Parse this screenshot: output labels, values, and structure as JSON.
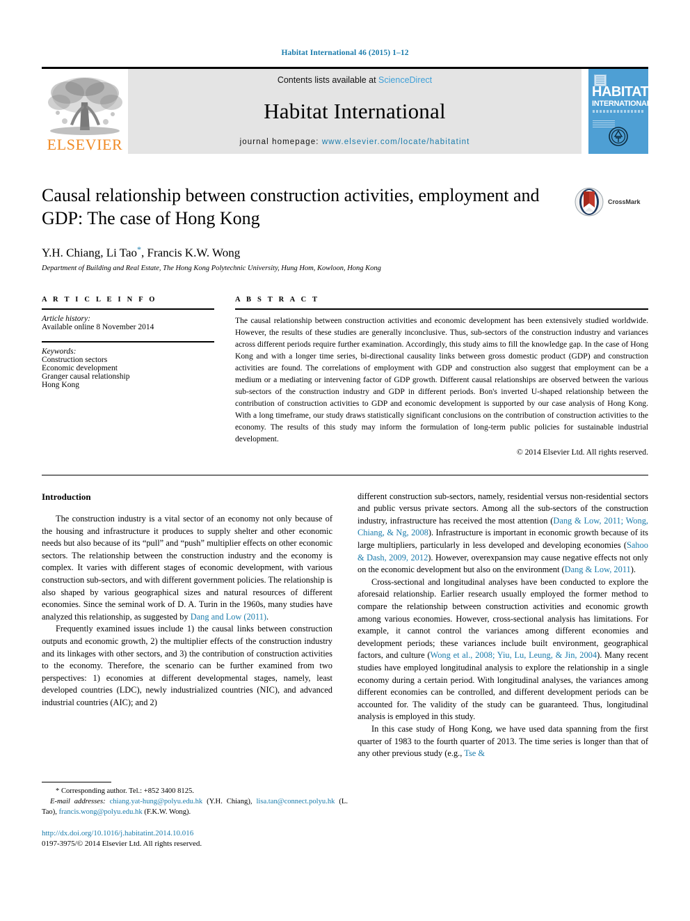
{
  "running_head": "Habitat International 46 (2015) 1–12",
  "masthead": {
    "publisher_name": "ELSEVIER",
    "contents_prefix": "Contents lists available at ",
    "contents_link": "ScienceDirect",
    "journal_title": "Habitat International",
    "homepage_prefix": "journal homepage: ",
    "homepage_url": "www.elsevier.com/locate/habitatint",
    "cover": {
      "line1": "HABITAT",
      "line2": "INTERNATIONAL"
    }
  },
  "article": {
    "title": "Causal relationship between construction activities, employment and GDP: The case of Hong Kong",
    "authors": "Y.H. Chiang, Li Tao",
    "authors_suffix": ", Francis K.W. Wong",
    "corresponding_marker": "*",
    "affiliation": "Department of Building and Real Estate, The Hong Kong Polytechnic University, Hung Hom, Kowloon, Hong Kong",
    "crossmark_label": "CrossMark"
  },
  "article_info": {
    "heading": "A R T I C L E   I N F O",
    "history_label": "Article history:",
    "history_value": "Available online 8 November 2014",
    "keywords_label": "Keywords:",
    "keywords": [
      "Construction sectors",
      "Economic development",
      "Granger causal relationship",
      "Hong Kong"
    ]
  },
  "abstract": {
    "heading": "A B S T R A C T",
    "text": "The causal relationship between construction activities and economic development has been extensively studied worldwide. However, the results of these studies are generally inconclusive. Thus, sub-sectors of the construction industry and variances across different periods require further examination. Accordingly, this study aims to fill the knowledge gap. In the case of Hong Kong and with a longer time series, bi-directional causality links between gross domestic product (GDP) and construction activities are found. The correlations of employment with GDP and construction also suggest that employment can be a medium or a mediating or intervening factor of GDP growth. Different causal relationships are observed between the various sub-sectors of the construction industry and GDP in different periods. Bon's inverted U-shaped relationship between the contribution of construction activities to GDP and economic development is supported by our case analysis of Hong Kong. With a long timeframe, our study draws statistically significant conclusions on the contribution of construction activities to the economy. The results of this study may inform the formulation of long-term public policies for sustainable industrial development.",
    "copyright": "© 2014 Elsevier Ltd. All rights reserved."
  },
  "body": {
    "section_heading": "Introduction",
    "left_p1": "The construction industry is a vital sector of an economy not only because of the housing and infrastructure it produces to supply shelter and other economic needs but also because of its “pull” and “push” multiplier effects on other economic sectors. The relationship between the construction industry and the economy is complex. It varies with different stages of economic development, with various construction sub-sectors, and with different government policies. The relationship is also shaped by various geographical sizes and natural resources of different economies. Since the seminal work of D. A. Turin in the 1960s, many studies have analyzed this relationship, as suggested by ",
    "left_p1_ref": "Dang and Low (2011)",
    "left_p1_end": ".",
    "left_p2": "Frequently examined issues include 1) the causal links between construction outputs and economic growth, 2) the multiplier effects of the construction industry and its linkages with other sectors, and 3) the contribution of construction activities to the economy. Therefore, the scenario can be further examined from two perspectives: 1) economies at different developmental stages, namely, least developed countries (LDC), newly industrialized countries (NIC), and advanced industrial countries (AIC); and 2)",
    "right_p1_a": "different construction sub-sectors, namely, residential versus non-residential sectors and public versus private sectors. Among all the sub-sectors of the construction industry, infrastructure has received the most attention (",
    "right_p1_ref1": "Dang & Low, 2011; Wong, Chiang, & Ng, 2008",
    "right_p1_b": "). Infrastructure is important in economic growth because of its large multipliers, particularly in less developed and developing economies (",
    "right_p1_ref2": "Sahoo & Dash, 2009, 2012",
    "right_p1_c": "). However, overexpansion may cause negative effects not only on the economic development but also on the environment (",
    "right_p1_ref3": "Dang & Low, 2011",
    "right_p1_d": ").",
    "right_p2_a": "Cross-sectional and longitudinal analyses have been conducted to explore the aforesaid relationship. Earlier research usually employed the former method to compare the relationship between construction activities and economic growth among various economies. However, cross-sectional analysis has limitations. For example, it cannot control the variances among different economies and development periods; these variances include built environment, geographical factors, and culture (",
    "right_p2_ref1": "Wong et al., 2008; Yiu, Lu, Leung, & Jin, 2004",
    "right_p2_b": "). Many recent studies have employed longitudinal analysis to explore the relationship in a single economy during a certain period. With longitudinal analyses, the variances among different economies can be controlled, and different development periods can be accounted for. The validity of the study can be guaranteed. Thus, longitudinal analysis is employed in this study.",
    "right_p3_a": "In this case study of Hong Kong, we have used data spanning from the first quarter of 1983 to the fourth quarter of 2013. The time series is longer than that of any other previous study (e.g., ",
    "right_p3_ref": "Tse &"
  },
  "footnote": {
    "corresponding": "* Corresponding author. Tel.: +852 3400 8125.",
    "email_label": "E-mail addresses:",
    "email1": "chiang.yat-hung@polyu.edu.hk",
    "email1_owner": "(Y.H. Chiang),",
    "email2": "lisa.tan@connect.polyu.hk",
    "email2_owner": "(L. Tao),",
    "email3": "francis.wong@polyu.edu.hk",
    "email3_owner": "(F.K.W. Wong)."
  },
  "doi_block": {
    "doi": "http://dx.doi.org/10.1016/j.habitatint.2014.10.016",
    "issn_line": "0197-3975/© 2014 Elsevier Ltd. All rights reserved."
  },
  "colors": {
    "link_blue": "#1a7bab",
    "sciencedirect_blue": "#3fa0d8",
    "elsevier_orange": "#f08a24",
    "cover_blue": "#4e9fd4",
    "masthead_gray": "#e4e4e4"
  }
}
